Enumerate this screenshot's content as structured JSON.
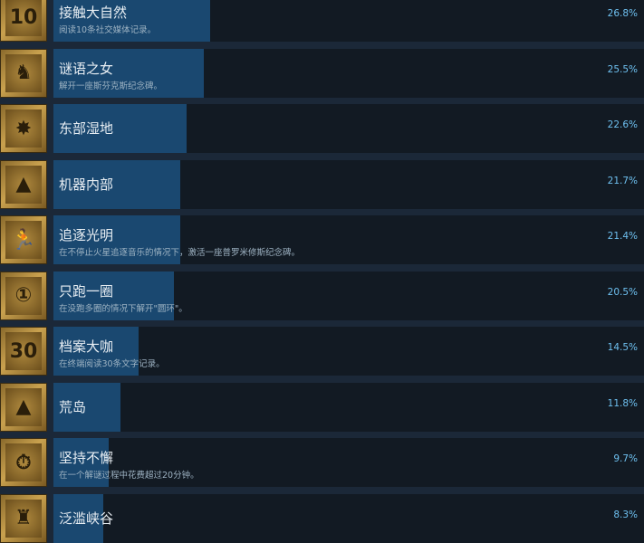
{
  "achievements": [
    {
      "title": "接触大自然",
      "desc": "阅读10条社交媒体记录。",
      "pct": "26.8%",
      "fill": 0.265,
      "icon": "social-media-10-icon",
      "glyph": "10"
    },
    {
      "title": "谜语之女",
      "desc": "解开一座斯芬克斯纪念碑。",
      "pct": "25.5%",
      "fill": 0.254,
      "icon": "sphinx-icon",
      "glyph": "♞"
    },
    {
      "title": "东部湿地",
      "desc": "",
      "pct": "22.6%",
      "fill": 0.225,
      "icon": "compass-star-icon",
      "glyph": "✸"
    },
    {
      "title": "机器内部",
      "desc": "",
      "pct": "21.7%",
      "fill": 0.214,
      "icon": "pyramid-eye-icon",
      "glyph": "▲"
    },
    {
      "title": "追逐光明",
      "desc": "在不停止火星追逐音乐的情况下，激活一座普罗米修斯纪念碑。",
      "pct": "21.4%",
      "fill": 0.214,
      "icon": "running-figure-icon",
      "glyph": "🏃"
    },
    {
      "title": "只跑一圈",
      "desc": "在没跑多圈的情况下解开\"圆环\"。",
      "pct": "20.5%",
      "fill": 0.204,
      "icon": "loop-one-icon",
      "glyph": "①"
    },
    {
      "title": "档案大咖",
      "desc": "在终端阅读30条文字记录。",
      "pct": "14.5%",
      "fill": 0.144,
      "icon": "document-30-icon",
      "glyph": "30"
    },
    {
      "title": "荒岛",
      "desc": "",
      "pct": "11.8%",
      "fill": 0.114,
      "icon": "island-pyramid-icon",
      "glyph": "▲"
    },
    {
      "title": "坚持不懈",
      "desc": "在一个解谜过程中花费超过20分钟。",
      "pct": "9.7%",
      "fill": 0.094,
      "icon": "stopwatch-icon",
      "glyph": "⏱"
    },
    {
      "title": "泛滥峡谷",
      "desc": "",
      "pct": "8.3%",
      "fill": 0.084,
      "icon": "canyon-tower-icon",
      "glyph": "♜"
    }
  ]
}
